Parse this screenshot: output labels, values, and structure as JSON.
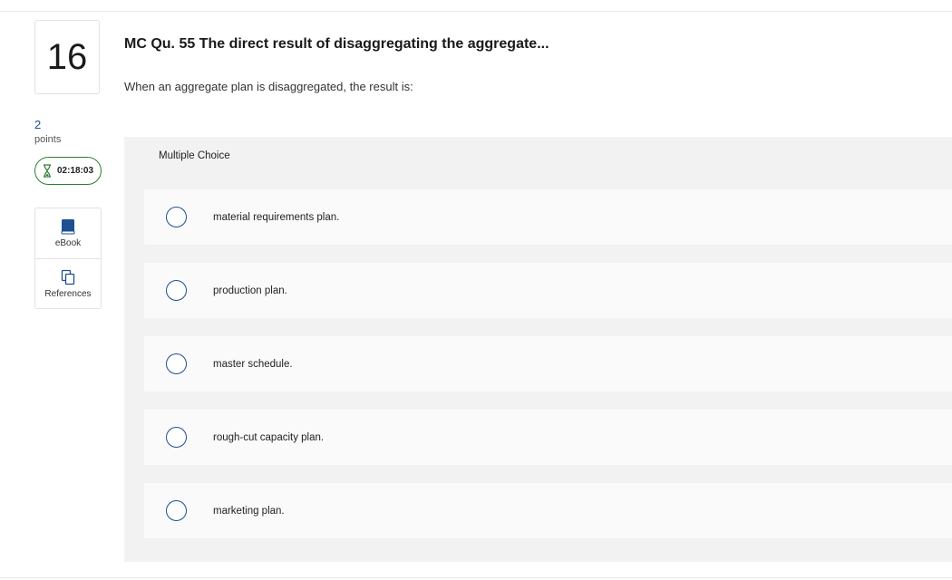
{
  "question": {
    "number": "16",
    "points_value": "2",
    "points_label": "points",
    "timer": "02:18:03",
    "title": "MC Qu. 55 The direct result of disaggregating the aggregate...",
    "prompt": "When an aggregate plan is disaggregated, the result is:"
  },
  "tools": [
    {
      "label": "eBook",
      "icon": "book-icon"
    },
    {
      "label": "References",
      "icon": "copy-icon"
    }
  ],
  "multiple_choice": {
    "header": "Multiple Choice",
    "options": [
      {
        "text": "material requirements plan.",
        "selected": false
      },
      {
        "text": "production plan.",
        "selected": false
      },
      {
        "text": "master schedule.",
        "selected": false
      },
      {
        "text": "rough-cut capacity plan.",
        "selected": false
      },
      {
        "text": "marketing plan.",
        "selected": false
      }
    ]
  },
  "colors": {
    "accent": "#1d4f91",
    "timer_border": "#2e7d32",
    "panel_bg": "#f2f2f2",
    "option_bg": "#fafafa"
  }
}
